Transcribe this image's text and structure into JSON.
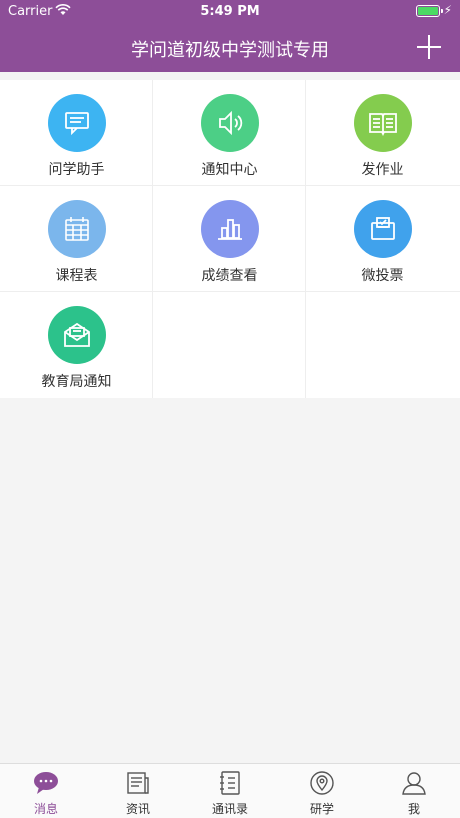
{
  "status_bar": {
    "carrier": "Carrier",
    "time": "5:49 PM"
  },
  "header": {
    "title": "学问道初级中学测试专用"
  },
  "grid": {
    "items": [
      {
        "label": "问学助手",
        "icon": "chat-icon",
        "color": "#3db4f2"
      },
      {
        "label": "通知中心",
        "icon": "speaker-icon",
        "color": "#4ccf86"
      },
      {
        "label": "发作业",
        "icon": "book-icon",
        "color": "#84cc4e"
      },
      {
        "label": "课程表",
        "icon": "calendar-icon",
        "color": "#7bb6ec"
      },
      {
        "label": "成绩查看",
        "icon": "bar-chart-icon",
        "color": "#8496ee"
      },
      {
        "label": "微投票",
        "icon": "ballot-icon",
        "color": "#40a2ec"
      },
      {
        "label": "教育局通知",
        "icon": "envelope-icon",
        "color": "#2cc28b"
      }
    ]
  },
  "tabbar": {
    "tabs": [
      {
        "label": "消息",
        "icon": "message-icon",
        "active": true
      },
      {
        "label": "资讯",
        "icon": "news-icon"
      },
      {
        "label": "通讯录",
        "icon": "contacts-icon"
      },
      {
        "label": "研学",
        "icon": "location-icon"
      },
      {
        "label": "我",
        "icon": "profile-icon"
      }
    ],
    "active_color": "#8d4e98"
  }
}
